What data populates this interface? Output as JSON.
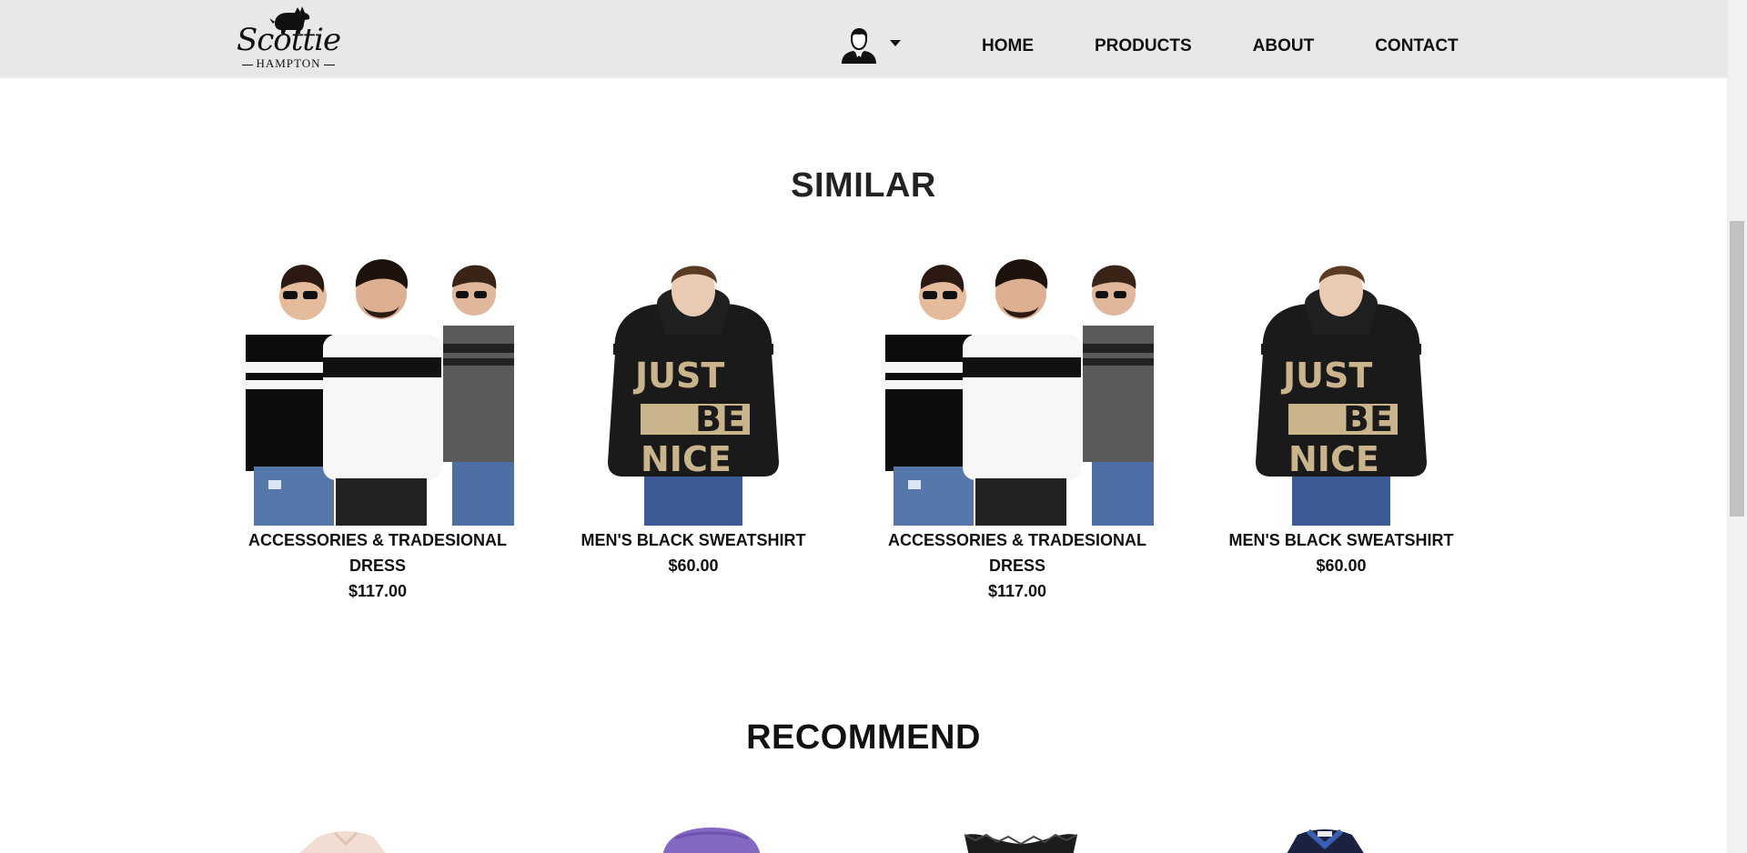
{
  "brand": {
    "name": "Scottie",
    "sub": "HAMPTON"
  },
  "header": {
    "user_icon": "user-avatar-icon",
    "dropdown_icon": "caret-down-icon",
    "nav": [
      "HOME",
      "PRODUCTS",
      "ABOUT",
      "CONTACT"
    ]
  },
  "similar": {
    "title": "SIMILAR",
    "products": [
      {
        "name": "ACCESSORIES & TRADESIONAL DRESS",
        "price": "$117.00",
        "image": "three-men-tshirts"
      },
      {
        "name": "MEN'S BLACK SWEATSHIRT",
        "price": "$60.00",
        "image": "just-be-nice-hoodie"
      },
      {
        "name": "ACCESSORIES & TRADESIONAL DRESS",
        "price": "$117.00",
        "image": "three-men-tshirts"
      },
      {
        "name": "MEN'S BLACK SWEATSHIRT",
        "price": "$60.00",
        "image": "just-be-nice-hoodie"
      }
    ]
  },
  "hoodie_print": [
    "JUST",
    "BE",
    "NICE"
  ],
  "recommend": {
    "title": "RECOMMEND",
    "thumbs": [
      "pink-shirt",
      "purple-cap",
      "black-lace-top",
      "navy-polo"
    ]
  },
  "colors": {
    "header_bg": "#e8e8e8",
    "text": "#111111"
  }
}
